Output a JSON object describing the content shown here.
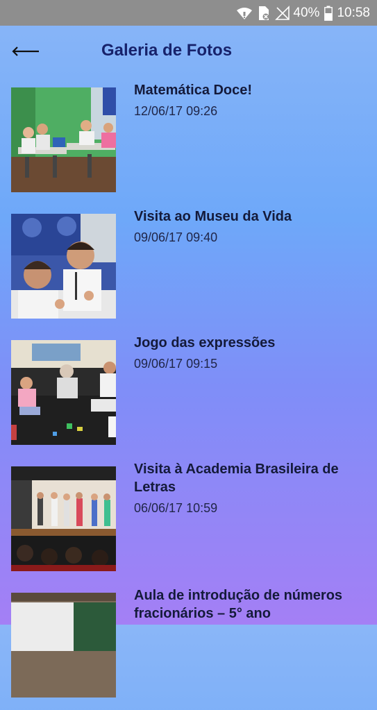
{
  "status_bar": {
    "battery": "40%",
    "time": "10:58",
    "icons": [
      "wifi-icon",
      "sim-card-icon",
      "no-signal-icon",
      "battery-icon"
    ]
  },
  "app_bar": {
    "title": "Galeria de Fotos",
    "back_icon": "arrow-left-icon"
  },
  "albums": [
    {
      "title": "Matemática Doce!",
      "date": "12/06/17 09:26"
    },
    {
      "title": "Visita ao Museu da Vida",
      "date": "09/06/17 09:40"
    },
    {
      "title": "Jogo das expressões",
      "date": "09/06/17 09:15"
    },
    {
      "title": "Visita à Academia Brasileira de Letras",
      "date": "06/06/17 10:59"
    },
    {
      "title": "Aula de introdução de números fracionários – 5° ano",
      "date": ""
    }
  ],
  "colors": {
    "title": "#17226b",
    "status_bar": "#8e8e8e"
  }
}
